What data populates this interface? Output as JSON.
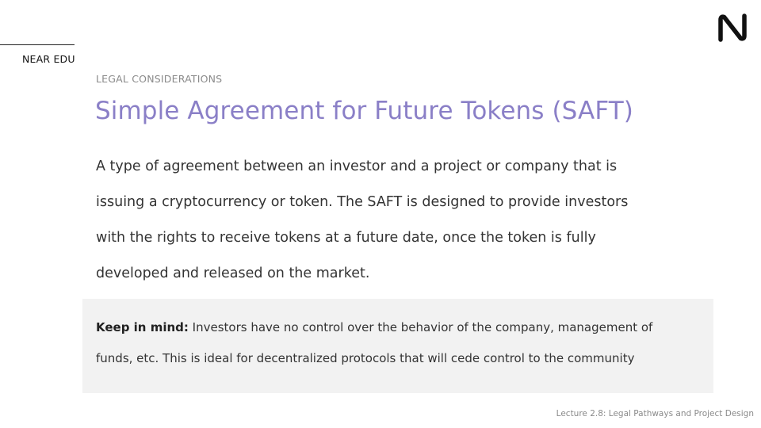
{
  "header": {
    "brand_label": "NEAR EDU",
    "logo_icon": "near-logo-icon"
  },
  "slide": {
    "eyebrow": "LEGAL CONSIDERATIONS",
    "title": "Simple Agreement for Future Tokens (SAFT)",
    "body_lines": [
      "A type of agreement between an investor and a project or company that is",
      "issuing a cryptocurrency or token. The SAFT is designed to provide investors",
      "with the rights to receive tokens at a future date, once the token is fully",
      "developed and released on the market."
    ],
    "note": {
      "label": "Keep in mind:",
      "line1_text": " Investors have no control over the behavior of the company, management of",
      "line2_text": "funds, etc. This is ideal for decentralized protocols that will cede control to the community"
    }
  },
  "footer": {
    "lecture": "Lecture 2.8: Legal Pathways and Project Design"
  },
  "colors": {
    "title": "#8a7fc7",
    "note_background": "#f2f2f2",
    "muted_text": "#8a8a8a"
  }
}
